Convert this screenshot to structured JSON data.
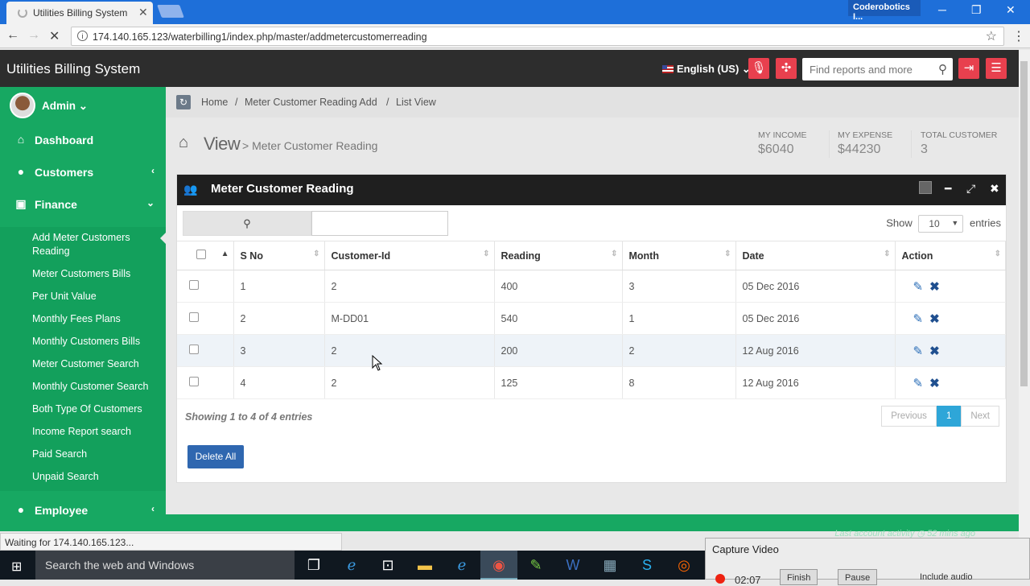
{
  "browser": {
    "tab_title": "Utilities Billing System",
    "profile": "Coderobotics I...",
    "url": "174.140.165.123/waterbilling1/index.php/master/addmetercustomerreading",
    "status": "Waiting for 174.140.165.123..."
  },
  "header": {
    "app_name": "Utilities Billing System",
    "language": "English (US)",
    "search_placeholder": "Find reports and more"
  },
  "sidebar": {
    "user": "Admin",
    "items": [
      {
        "label": "Dashboard",
        "icon": "dashboard-icon"
      },
      {
        "label": "Customers",
        "icon": "user-icon"
      },
      {
        "label": "Finance",
        "icon": "money-icon"
      },
      {
        "label": "Employee",
        "icon": "user-icon"
      }
    ],
    "finance_sub": [
      "Add Meter Customers Reading",
      "Meter Customers Bills",
      "Per Unit Value",
      "Monthly Fees Plans",
      "Monthly Customers Bills",
      "Meter Customer Search",
      "Monthly Customer Search",
      "Both Type Of Customers",
      "Income Report search",
      "Paid Search",
      "Unpaid Search"
    ]
  },
  "breadcrumb": [
    "Home",
    "Meter Customer Reading Add",
    "List View"
  ],
  "page": {
    "view": "View",
    "subtitle": "> Meter Customer Reading"
  },
  "stats": [
    {
      "label": "MY INCOME",
      "value": "$6040"
    },
    {
      "label": "MY EXPENSE",
      "value": "$44230"
    },
    {
      "label": "TOTAL CUSTOMER",
      "value": "3"
    }
  ],
  "panel": {
    "title": "Meter Customer Reading",
    "show_label": "Show",
    "entries_value": "10",
    "entries_label": "entries",
    "columns": [
      "S No",
      "Customer-Id",
      "Reading",
      "Month",
      "Date",
      "Action"
    ],
    "rows": [
      [
        "1",
        "2",
        "400",
        "3",
        "05 Dec 2016"
      ],
      [
        "2",
        "M-DD01",
        "540",
        "1",
        "05 Dec 2016"
      ],
      [
        "3",
        "2",
        "200",
        "2",
        "12 Aug 2016"
      ],
      [
        "4",
        "2",
        "125",
        "8",
        "12 Aug 2016"
      ]
    ],
    "info": "Showing 1 to 4 of 4 entries",
    "pager": {
      "prev": "Previous",
      "page": "1",
      "next": "Next"
    },
    "delete_all": "Delete All"
  },
  "footer": {
    "last_activity": "Last account activity ◷ 52 mins ago"
  },
  "taskbar": {
    "search": "Search the web and Windows"
  },
  "capture": {
    "title": "Capture Video",
    "time": "02:07",
    "finish": "Finish",
    "pause": "Pause",
    "audio": "Include audio"
  }
}
